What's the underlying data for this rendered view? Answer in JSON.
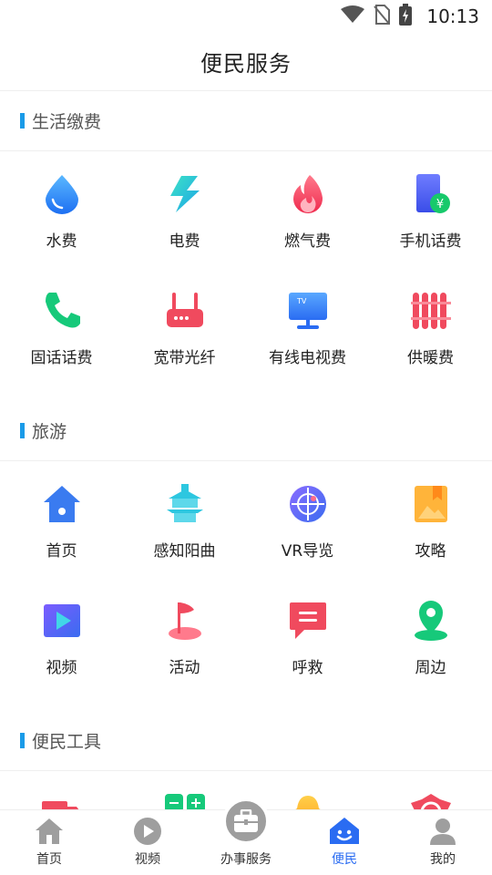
{
  "status_bar": {
    "time": "10:13"
  },
  "header": {
    "title": "便民服务"
  },
  "sections": [
    {
      "title": "生活缴费",
      "items": [
        {
          "label": "水费",
          "icon": "water-drop-icon"
        },
        {
          "label": "电费",
          "icon": "lightning-icon"
        },
        {
          "label": "燃气费",
          "icon": "flame-icon"
        },
        {
          "label": "手机话费",
          "icon": "phone-recharge-icon"
        },
        {
          "label": "固话话费",
          "icon": "telephone-icon"
        },
        {
          "label": "宽带光纤",
          "icon": "router-icon"
        },
        {
          "label": "有线电视费",
          "icon": "tv-icon"
        },
        {
          "label": "供暖费",
          "icon": "radiator-icon"
        }
      ]
    },
    {
      "title": "旅游",
      "items": [
        {
          "label": "首页",
          "icon": "house-icon"
        },
        {
          "label": "感知阳曲",
          "icon": "pagoda-icon"
        },
        {
          "label": "VR导览",
          "icon": "vr-target-icon"
        },
        {
          "label": "攻略",
          "icon": "bookmark-icon"
        },
        {
          "label": "视频",
          "icon": "video-play-icon"
        },
        {
          "label": "活动",
          "icon": "flag-icon"
        },
        {
          "label": "呼救",
          "icon": "message-icon"
        },
        {
          "label": "周边",
          "icon": "location-pin-icon"
        }
      ]
    },
    {
      "title": "便民工具",
      "items": [
        {
          "label": "",
          "icon": "truck-icon"
        },
        {
          "label": "",
          "icon": "calculator-icon"
        },
        {
          "label": "",
          "icon": "cloud-icon"
        },
        {
          "label": "",
          "icon": "train-icon"
        }
      ]
    }
  ],
  "bottom_nav": [
    {
      "label": "首页",
      "icon": "home-icon",
      "active": false
    },
    {
      "label": "视频",
      "icon": "play-circle-icon",
      "active": false
    },
    {
      "label": "办事服务",
      "icon": "briefcase-icon",
      "active": false,
      "center": true
    },
    {
      "label": "便民",
      "icon": "smile-icon",
      "active": true
    },
    {
      "label": "我的",
      "icon": "person-icon",
      "active": false
    }
  ],
  "colors": {
    "accent_bar": "#1a9be8",
    "active_tab": "#2a6cf2",
    "center_button": "#9e9e9e"
  }
}
